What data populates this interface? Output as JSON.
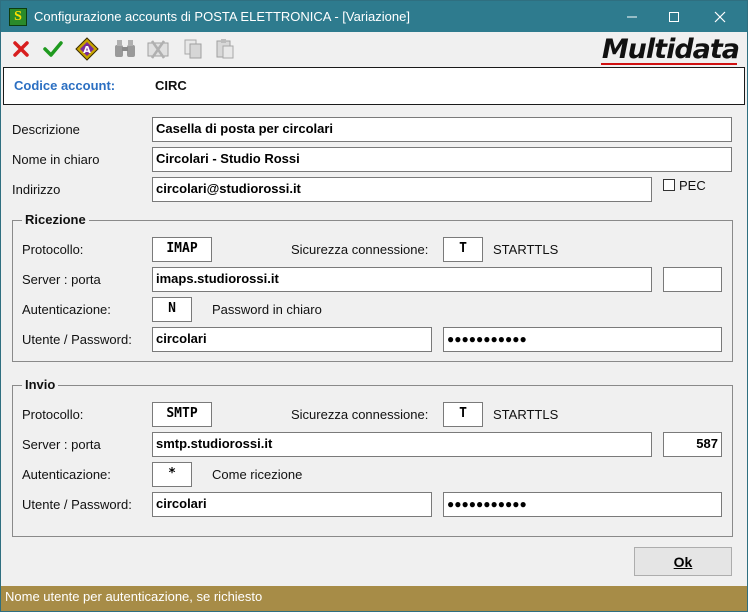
{
  "window": {
    "app_icon": "S",
    "title": "Configurazione accounts di POSTA ELETTRONICA - [Variazione]",
    "controls": {
      "minimize": "─",
      "maximize": "☐",
      "close": "✕"
    }
  },
  "toolbar": {
    "icons": [
      "close-x-icon",
      "checkmark-icon",
      "tag-icon",
      "binoculars-icon",
      "delete-card-icon",
      "copy-doc-icon",
      "paste-doc-icon"
    ],
    "logo": "Multidata",
    "colors": {
      "cancel": "#d81e1e",
      "confirm": "#1f9a1f",
      "accent": "#c8a400"
    }
  },
  "header": {
    "label": "Codice account:",
    "value": "CIRC"
  },
  "general": {
    "descrizione_label": "Descrizione",
    "descrizione_value": "Casella di posta per circolari",
    "nome_label": "Nome in chiaro",
    "nome_value": "Circolari - Studio Rossi",
    "indirizzo_label": "Indirizzo",
    "indirizzo_value": "circolari@studiorossi.it",
    "pec_label": "PEC",
    "pec_checked": false
  },
  "ricezione": {
    "title": "Ricezione",
    "protocollo_label": "Protocollo:",
    "protocollo_value": "IMAP",
    "sicurezza_label": "Sicurezza connessione:",
    "sicurezza_code": "T",
    "sicurezza_desc": "STARTTLS",
    "server_label": "Server : porta",
    "server_value": "imaps.studiorossi.it",
    "porta_value": "",
    "auth_label": "Autenticazione:",
    "auth_code": "N",
    "auth_desc": "Password in chiaro",
    "utente_label": "Utente / Password:",
    "utente_value": "circolari",
    "password_value": "●●●●●●●●●●●"
  },
  "invio": {
    "title": "Invio",
    "protocollo_label": "Protocollo:",
    "protocollo_value": "SMTP",
    "sicurezza_label": "Sicurezza connessione:",
    "sicurezza_code": "T",
    "sicurezza_desc": "STARTTLS",
    "server_label": "Server : porta",
    "server_value": "smtp.studiorossi.it",
    "porta_value": "587",
    "auth_label": "Autenticazione:",
    "auth_code": "*",
    "auth_desc": "Come ricezione",
    "utente_label": "Utente / Password:",
    "utente_value": "circolari",
    "password_value": "●●●●●●●●●●●"
  },
  "actions": {
    "ok_label": "Ok"
  },
  "status": {
    "text": "Nome utente per autenticazione, se richiesto"
  }
}
